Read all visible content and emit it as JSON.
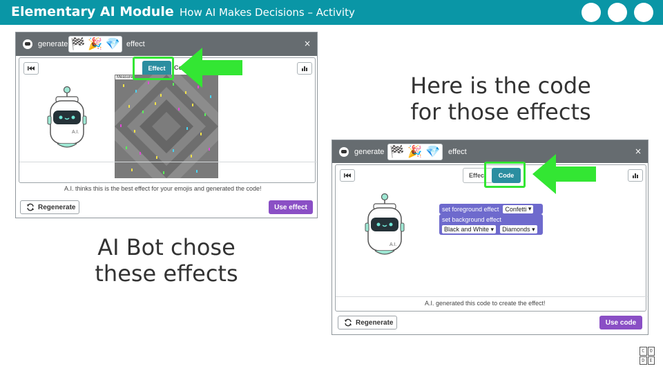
{
  "banner": {
    "title": "Elementary AI Module",
    "subtitle": "How AI Makes Decisions – Activity",
    "color": "#0a96a6"
  },
  "left_window": {
    "generate_label": "generate",
    "effect_label": "effect",
    "emojis": [
      "🏁",
      "🎉",
      "💎"
    ],
    "close": "×",
    "tab_effect": "Effect",
    "tab_code": "Code",
    "preview_label": "Measure",
    "robot_label": "A.I.",
    "footer": "A.I. thinks this is the best effect for your emojis and generated the code!",
    "regenerate": "Regenerate",
    "use_button": "Use effect"
  },
  "right_window": {
    "generate_label": "generate",
    "effect_label": "effect",
    "emojis": [
      "🏁",
      "🎉",
      "💎"
    ],
    "close": "×",
    "tab_effect": "Effect",
    "tab_code": "Code",
    "robot_label": "A.I.",
    "code_blocks": {
      "foreground_label": "set foreground effect",
      "foreground_value": "Confetti",
      "background_label": "set background effect",
      "background_palette": "Black and White",
      "background_pattern": "Diamonds"
    },
    "footer": "A.I. generated this code to create the effect!",
    "regenerate": "Regenerate",
    "use_button": "Use code"
  },
  "captions": {
    "right_top": [
      "Here is the code",
      "for those effects"
    ],
    "left_bottom": [
      "AI Bot chose",
      "these effects"
    ]
  },
  "logo": [
    "C",
    "O",
    "D",
    "E"
  ],
  "colors": {
    "highlight_green": "#33e633",
    "button_purple": "#8a4fc5",
    "tab_teal": "#2b8ea0"
  }
}
